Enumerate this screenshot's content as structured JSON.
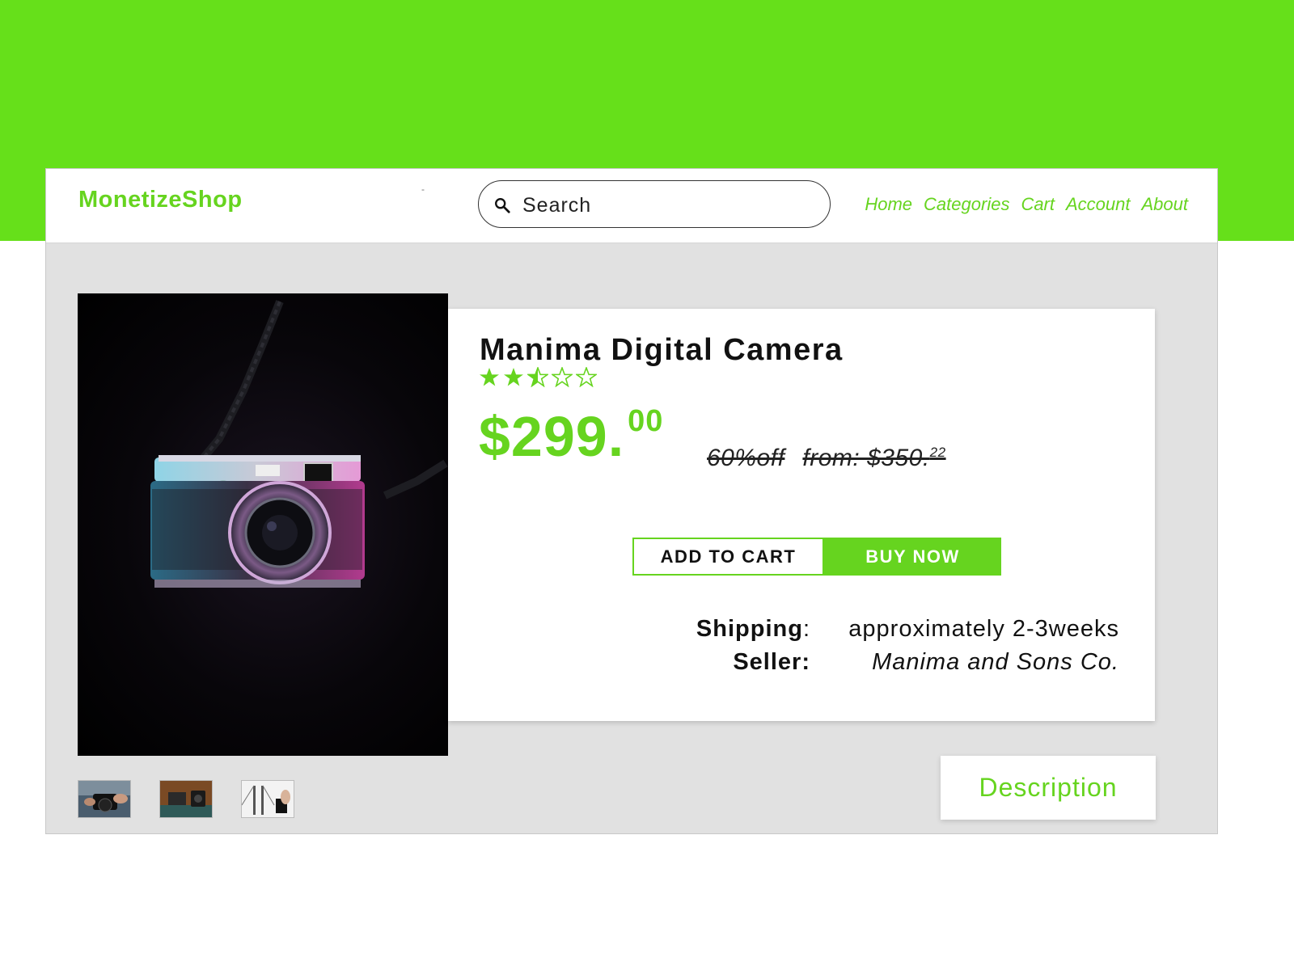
{
  "brand": {
    "name": "MonetizeShop",
    "dash": "-"
  },
  "search": {
    "placeholder": "Search"
  },
  "nav": {
    "links": [
      "Home",
      "Categories",
      "Cart",
      "Account",
      "About"
    ]
  },
  "product": {
    "title": "Manima Digital Camera",
    "rating": 2.5,
    "rating_max": 5,
    "price_main": "$299.",
    "price_cents": "00",
    "discount": "60%off",
    "original_price": "from: $350.",
    "original_cents": "22",
    "add_to_cart": "ADD TO CART",
    "buy_now": "BUY NOW",
    "shipping_label": "Shipping",
    "shipping_colon": ":",
    "shipping_value": "approximately 2-3weeks",
    "seller_label": "Seller:",
    "seller_value": "Manima and Sons Co."
  },
  "tabs": {
    "description": "Description"
  },
  "colors": {
    "accent": "#66d41f",
    "banner": "#66e01a",
    "panel": "#e1e1e1"
  },
  "thumbnails": [
    "camera-in-hands-thumbnail",
    "camera-on-wood-thumbnail",
    "bridge-photo-thumbnail"
  ]
}
